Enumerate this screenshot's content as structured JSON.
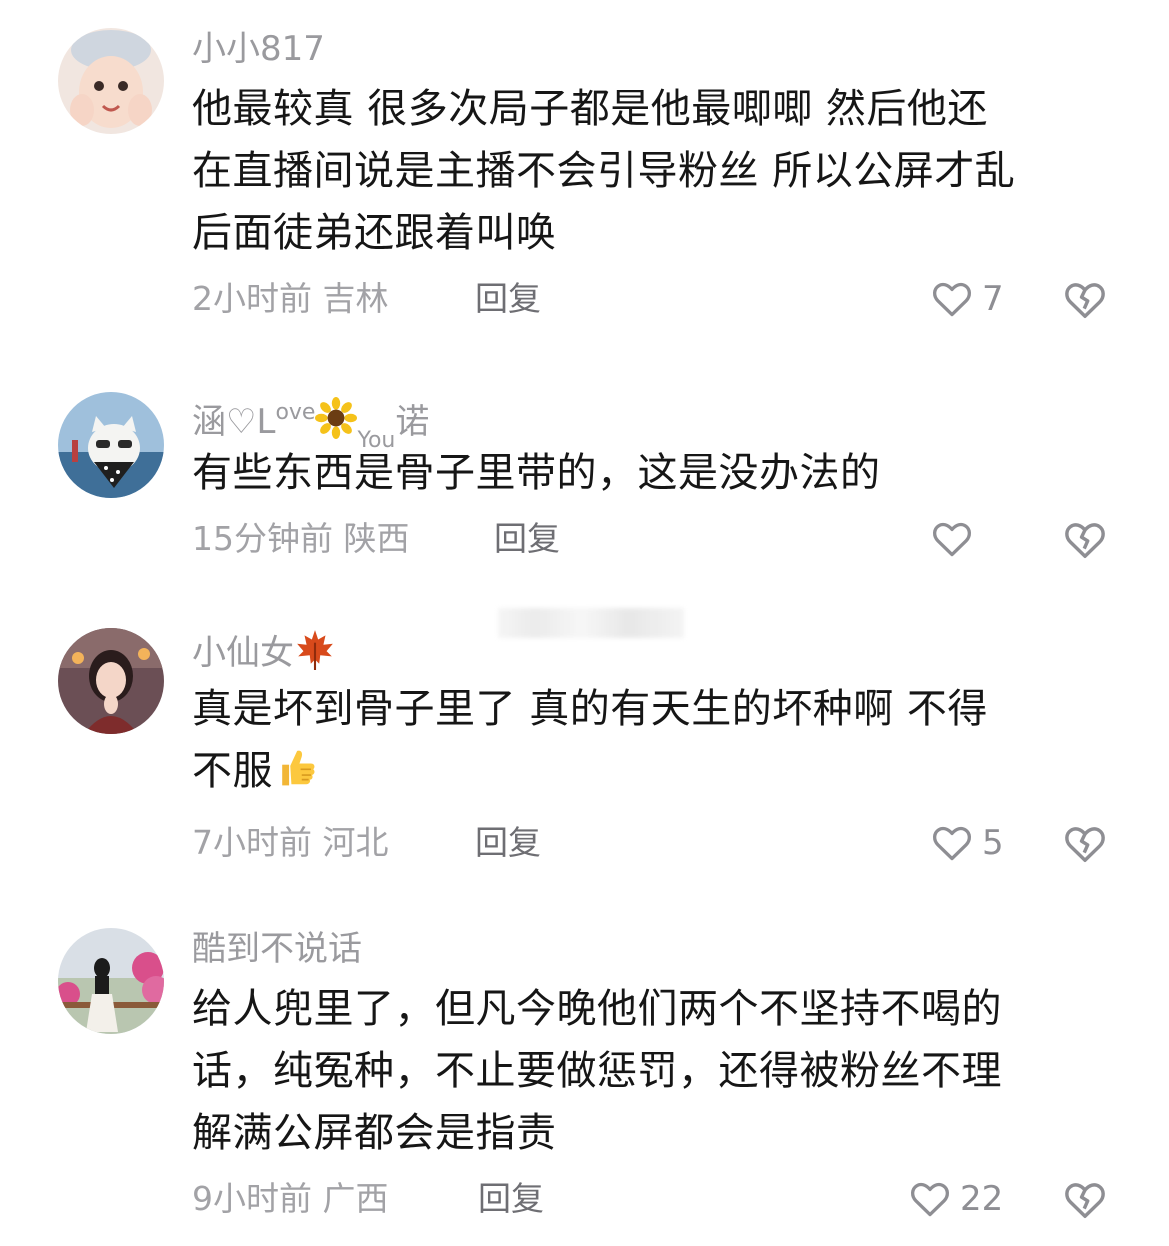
{
  "comments": [
    {
      "username": "小小817",
      "text_lines": [
        "他最较真 很多次局子都是他最唧唧  然后他还",
        "在直播间说是主播不会引导粉丝 所以公屏才乱",
        "后面徒弟还跟着叫唤"
      ],
      "time": "2小时前",
      "location": "吉林",
      "reply_label": "回复",
      "likes": "7",
      "avatar": "child-avatar"
    },
    {
      "username": "涵♡L",
      "username_sup": "ove",
      "username_sub": "You",
      "username_tail": "诺",
      "username_emoji": "sunflower-emoji",
      "text_lines": [
        "有些东西是骨子里带的，这是没办法的"
      ],
      "time": "15分钟前",
      "location": "陕西",
      "reply_label": "回复",
      "likes": "",
      "avatar": "cat-avatar"
    },
    {
      "username": "小仙女",
      "username_emoji": "maple-leaf-emoji",
      "text_lines": [
        "真是坏到骨子里了  真的有天生的坏种啊  不得",
        "不服"
      ],
      "text_emoji": "thumbs-up-emoji",
      "time": "7小时前",
      "location": "河北",
      "reply_label": "回复",
      "likes": "5",
      "avatar": "girl-avatar"
    },
    {
      "username": "酷到不说话",
      "text_lines": [
        "给人兜里了，但凡今晚他们两个不坚持不喝的",
        "话，纯冤种，不止要做惩罚，还得被粉丝不理",
        "解满公屏都会是指责"
      ],
      "time": "9小时前",
      "location": "广西",
      "reply_label": "回复",
      "likes": "22",
      "avatar": "garden-avatar"
    }
  ],
  "icons": {
    "like": "heart-outline-icon",
    "dislike": "broken-heart-icon"
  },
  "colors": {
    "text": "#161616",
    "meta": "#a2a2a6",
    "reply": "#6e6e73",
    "icon": "#8e8e93"
  }
}
